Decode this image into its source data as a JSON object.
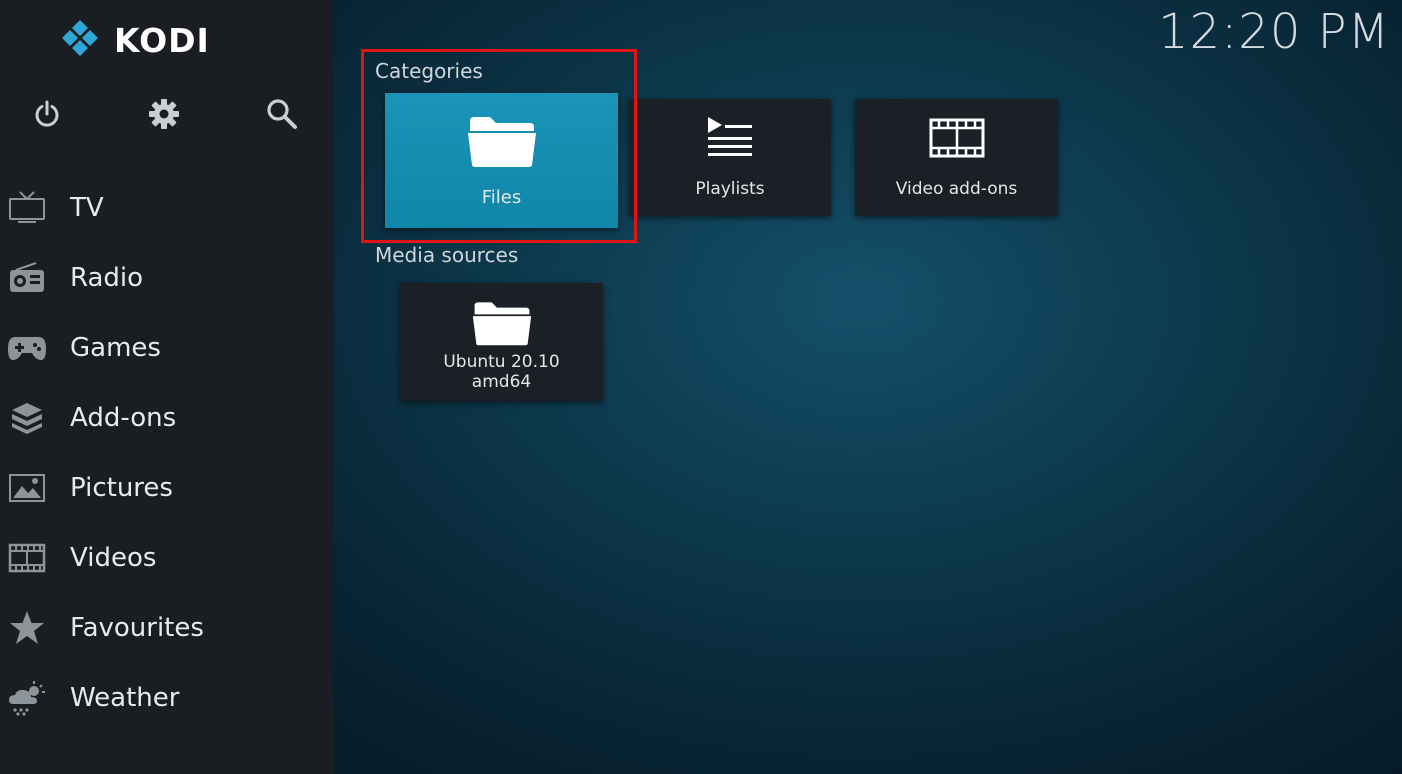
{
  "app": {
    "name": "KODI",
    "clock": "12:20 PM"
  },
  "top_controls": [
    {
      "name": "power-icon"
    },
    {
      "name": "gear-icon"
    },
    {
      "name": "search-icon"
    }
  ],
  "sidebar": {
    "items": [
      {
        "label": "TV",
        "icon": "tv-icon"
      },
      {
        "label": "Radio",
        "icon": "radio-icon"
      },
      {
        "label": "Games",
        "icon": "gamepad-icon"
      },
      {
        "label": "Add-ons",
        "icon": "addons-box-icon"
      },
      {
        "label": "Pictures",
        "icon": "picture-icon"
      },
      {
        "label": "Videos",
        "icon": "film-icon"
      },
      {
        "label": "Favourites",
        "icon": "star-icon"
      },
      {
        "label": "Weather",
        "icon": "weather-icon"
      }
    ]
  },
  "main": {
    "categories": {
      "title": "Categories",
      "tiles": [
        {
          "label": "Files",
          "icon": "folder-icon",
          "focused": true
        },
        {
          "label": "Playlists",
          "icon": "playlist-icon",
          "focused": false
        },
        {
          "label": "Video add-ons",
          "icon": "film-icon",
          "focused": false
        }
      ]
    },
    "media_sources": {
      "title": "Media sources",
      "tiles": [
        {
          "label_line1": "Ubuntu 20.10",
          "label_line2": "amd64",
          "icon": "folder-icon"
        }
      ]
    }
  },
  "colors": {
    "accent": "#12a0c4",
    "highlight_box": "#e01414",
    "sidebar_bg": "#1a1d21",
    "tile_bg": "#1b2026"
  }
}
